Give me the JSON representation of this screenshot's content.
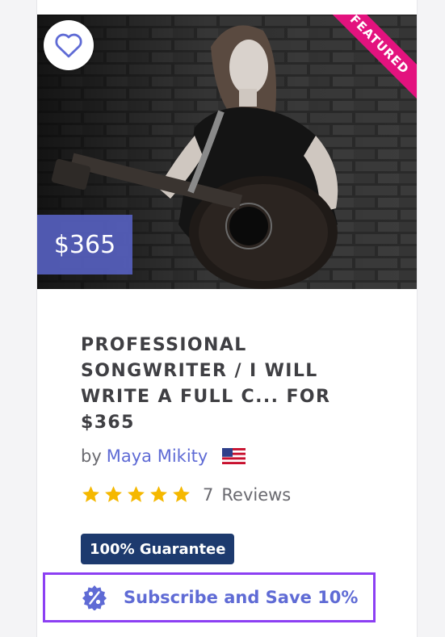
{
  "listing": {
    "title": "PROFESSIONAL SONGWRITER / I WILL WRITE A FULL C... FOR $365",
    "price": "$365",
    "featured_label": "FEATURED",
    "seller": {
      "by": "by",
      "name": "Maya Mikity",
      "flag_icon": "us-flag-icon"
    },
    "rating": {
      "stars": 5,
      "count": "7",
      "reviews_label": "Reviews"
    },
    "guarantee_badge": "100% Guarantee",
    "subscribe": {
      "label": "Subscribe and Save 10%",
      "icon": "percent-badge-icon"
    },
    "favorite_icon": "heart-icon"
  },
  "colors": {
    "accent": "#5f6bd5",
    "price_tag": "#5660be",
    "featured": "#e3127e",
    "badge": "#1d3a6e",
    "subscribe_border": "#8c3ff3",
    "star": "#f5b800"
  }
}
